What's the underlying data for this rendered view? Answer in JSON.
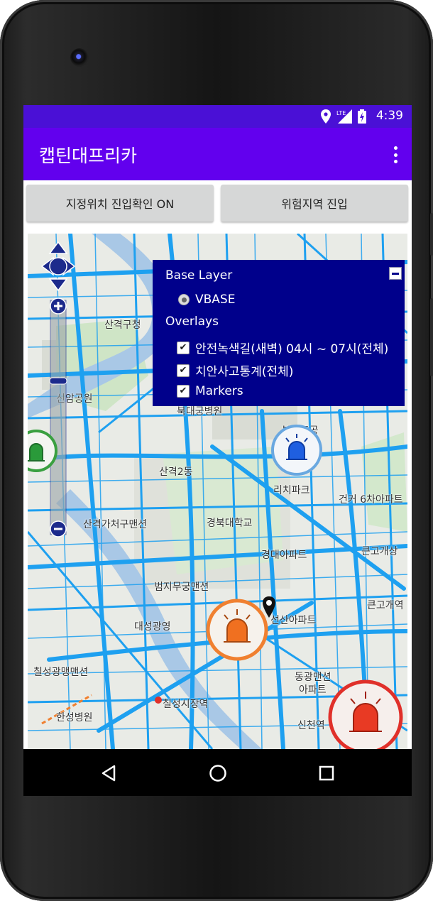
{
  "status_bar": {
    "time": "4:39",
    "network": "LTE"
  },
  "app": {
    "title": "캡틴대프리카"
  },
  "buttons": {
    "geofence_label": "지정위치 진입확인 ON",
    "danger_zone_label": "위험지역 진입"
  },
  "layer_switcher": {
    "base_header": "Base Layer",
    "base_layers": [
      {
        "label": "VBASE",
        "selected": true
      }
    ],
    "overlay_header": "Overlays",
    "overlays": [
      {
        "label": "안전녹색길(새벽) 04시 ~ 07시(전체)",
        "checked": true
      },
      {
        "label": "치안사고통계(전체)",
        "checked": true
      },
      {
        "label": "Markers",
        "checked": true
      }
    ]
  },
  "map": {
    "labels": [
      "신암공원",
      "경북대학교",
      "경대아파트",
      "리치파크",
      "북천주공",
      "범지무궁맨션",
      "선산아파트",
      "동광맨션",
      "아파트",
      "신천역",
      "한성병원",
      "칠성광맹맨션",
      "산격구청",
      "북대궁병원",
      "건커 6차아파트",
      "큰고개상",
      "큰고개역",
      "산격2동",
      "대성광영",
      "산격가처구맨션",
      "칠성시장역"
    ]
  },
  "colors": {
    "status_bar": "#4a10d6",
    "app_bar": "#6200ee",
    "layer_panel": "#00008b",
    "road": "#1ea0f0"
  },
  "icons": {
    "status": [
      "location-icon",
      "signal-icon",
      "battery-icon"
    ],
    "nav": [
      "back-icon",
      "home-icon",
      "recents-icon"
    ],
    "map": [
      "green-siren-icon",
      "blue-siren-icon",
      "orange-siren-icon",
      "red-siren-icon",
      "location-pin-icon"
    ]
  }
}
